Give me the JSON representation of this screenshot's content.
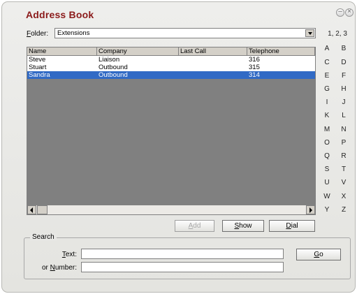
{
  "window": {
    "title": "Address Book"
  },
  "folder": {
    "label_underlined": "F",
    "label_rest": "older:",
    "value": "Extensions"
  },
  "table": {
    "columns": [
      "Name",
      "Company",
      "Last Call",
      "Telephone"
    ],
    "rows": [
      [
        "Steve",
        "Liaison",
        "",
        "316"
      ],
      [
        "Stuart",
        "Outbound",
        "",
        "315"
      ],
      [
        "Sandra",
        "Outbound",
        "",
        "314"
      ]
    ],
    "selected_row": 2
  },
  "index_links": [
    "1, 2, 3",
    "A",
    "B",
    "C",
    "D",
    "E",
    "F",
    "G",
    "H",
    "I",
    "J",
    "K",
    "L",
    "M",
    "N",
    "O",
    "P",
    "Q",
    "R",
    "S",
    "T",
    "U",
    "V",
    "W",
    "X",
    "Y",
    "Z"
  ],
  "buttons": {
    "add": {
      "u": "A",
      "rest": "dd",
      "enabled": false
    },
    "show": {
      "u": "S",
      "rest": "how"
    },
    "dial": {
      "u": "D",
      "rest": "ial"
    },
    "go": {
      "u": "G",
      "rest": "o"
    }
  },
  "search": {
    "title": "Search",
    "text_label_u": "T",
    "text_label_rest": "ext:",
    "number_label_pre": "or ",
    "number_label_u": "N",
    "number_label_rest": "umber:",
    "text_value": "",
    "number_value": ""
  },
  "colors": {
    "title": "#8b1a1a",
    "selection": "#316ac5",
    "list_bg": "#808080"
  }
}
